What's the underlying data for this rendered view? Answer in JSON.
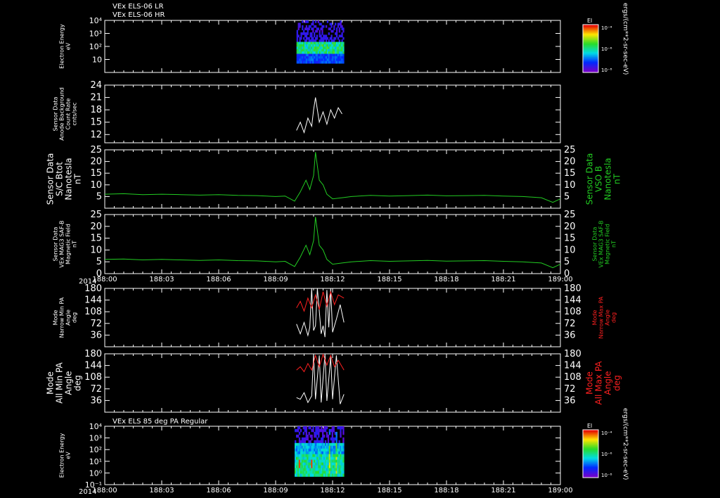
{
  "header": {
    "line1": "VEx ELS-06 LR",
    "line2": "VEx ELS-06 HR",
    "bottom_title": "VEx ELS 85 deg PA Regular"
  },
  "time_axis": {
    "year": "2014",
    "ticks": [
      "188:00",
      "188:03",
      "188:06",
      "188:09",
      "188:12",
      "188:15",
      "188:18",
      "188:21",
      "189:00"
    ]
  },
  "colors": {
    "white": "#ffffff",
    "green": "#22cc22",
    "red": "#ff2020"
  },
  "colorbar": {
    "label": "El",
    "unit": "ergs/(cm**2-sr-sec-eV)",
    "top_ticks": [
      "10⁻⁴",
      "10⁻⁶",
      "10⁻⁸"
    ],
    "bottom_ticks": [
      "10⁻⁴",
      "10⁻⁶",
      "10⁻⁸"
    ]
  },
  "chart_data": [
    {
      "type": "heatmap",
      "panel": "electron-energy-lr-hr",
      "ylabel": [
        "Electron Energy",
        "eV"
      ],
      "yscale": "log",
      "ylim": [
        1,
        10000
      ],
      "yticks": [
        "10",
        "10²",
        "10³",
        "10⁴"
      ],
      "ytick_values": [
        10,
        100,
        1000,
        10000
      ],
      "xrange": [
        0,
        24
      ],
      "data_x_range": [
        10.1,
        12.6
      ],
      "data_y_range": [
        5,
        10000
      ],
      "note": ""
    },
    {
      "type": "line",
      "panel": "anode-background",
      "ylabel": [
        "Sensor Data",
        "Anode Background",
        "Count Rate",
        "cnts/sec"
      ],
      "ylim": [
        10,
        24
      ],
      "yticks": [
        12,
        15,
        18,
        21,
        24
      ],
      "series": [
        {
          "color": "white",
          "x": [
            10.1,
            10.3,
            10.5,
            10.7,
            10.9,
            11.0,
            11.1,
            11.3,
            11.5,
            11.7,
            11.9,
            12.1,
            12.3,
            12.5
          ],
          "y": [
            13,
            15,
            12.5,
            16,
            14,
            18,
            21,
            15,
            17.5,
            14.5,
            18,
            16,
            18.5,
            17
          ]
        }
      ]
    },
    {
      "type": "line",
      "panel": "sc-btot",
      "ylabel": [
        "Sensor Data",
        "S/C Btot",
        "Nanotesla",
        "nT"
      ],
      "ylabel_right": [
        "Sensor Data",
        "VSO B",
        "Nanotesla",
        "nT"
      ],
      "ylim": [
        0,
        25
      ],
      "yticks": [
        5,
        10,
        15,
        20,
        25
      ],
      "series": [
        {
          "color": "green",
          "x": [
            0,
            1,
            2,
            3,
            4,
            5,
            6,
            7,
            8,
            9,
            9.5,
            10,
            10.3,
            10.6,
            10.8,
            11.0,
            11.1,
            11.3,
            11.5,
            11.7,
            12,
            12.5,
            13,
            14,
            15,
            16,
            17,
            18,
            19,
            20,
            21,
            22,
            23,
            23.6,
            24
          ],
          "y": [
            6,
            6.2,
            5.8,
            6,
            5.8,
            5.6,
            5.8,
            5.5,
            5.4,
            5,
            5.2,
            3,
            7,
            12,
            8,
            14,
            24,
            12,
            10,
            6,
            4,
            4.5,
            5,
            5.5,
            5.2,
            5.4,
            5.6,
            5.3,
            5.4,
            5.5,
            5.2,
            5,
            4.5,
            2.5,
            4
          ]
        }
      ]
    },
    {
      "type": "line",
      "panel": "mag-saf-b",
      "ylabel": [
        "Sensor Data",
        "VEx MAG3 SAF-B",
        "Magnetic Field",
        "nT"
      ],
      "ylabel_right": [
        "Sensor Data",
        "VEx MAG3 SAF-B",
        "Magnetic Field",
        "nT"
      ],
      "ylim": [
        0,
        25
      ],
      "yticks": [
        0,
        5,
        10,
        15,
        20,
        25
      ],
      "series": [
        {
          "color": "green",
          "x": [
            0,
            1,
            2,
            3,
            4,
            5,
            6,
            7,
            8,
            9,
            9.5,
            10,
            10.3,
            10.6,
            10.8,
            11.0,
            11.1,
            11.3,
            11.5,
            11.7,
            12,
            12.5,
            13,
            14,
            15,
            16,
            17,
            18,
            19,
            20,
            21,
            22,
            23,
            23.6,
            24
          ],
          "y": [
            6,
            6.2,
            5.8,
            6,
            5.8,
            5.6,
            5.8,
            5.5,
            5.4,
            5,
            5.2,
            3,
            7,
            12,
            8,
            14,
            24,
            12,
            10,
            6,
            4,
            4.5,
            5,
            5.5,
            5.2,
            5.4,
            5.6,
            5.3,
            5.4,
            5.5,
            5.2,
            5,
            4.5,
            2.5,
            4
          ]
        }
      ]
    },
    {
      "type": "line",
      "panel": "narrow-pa",
      "ylabel": [
        "Mode",
        "Narrow Min PA",
        "Angle",
        "deg"
      ],
      "ylabel_right": [
        "Mode",
        "Narrow Max PA",
        "Angle",
        "deg"
      ],
      "ylim": [
        0,
        180
      ],
      "yticks": [
        36,
        72,
        108,
        144,
        180
      ],
      "series": [
        {
          "name": "Narrow Min PA",
          "color": "white",
          "x": [
            10.1,
            10.3,
            10.5,
            10.7,
            10.8,
            10.9,
            11.0,
            11.1,
            11.2,
            11.4,
            11.5,
            11.6,
            11.7,
            11.8,
            11.9,
            12.0,
            12.2,
            12.4,
            12.6
          ],
          "y": [
            70,
            40,
            75,
            35,
            60,
            180,
            50,
            65,
            180,
            40,
            65,
            30,
            175,
            60,
            180,
            45,
            85,
            130,
            75
          ]
        },
        {
          "name": "Narrow Max PA",
          "color": "red",
          "x": [
            10.1,
            10.3,
            10.5,
            10.7,
            10.9,
            11.1,
            11.3,
            11.5,
            11.7,
            11.9,
            12.1,
            12.3,
            12.6
          ],
          "y": [
            120,
            140,
            110,
            150,
            120,
            160,
            115,
            170,
            125,
            170,
            130,
            160,
            150
          ]
        }
      ]
    },
    {
      "type": "line",
      "panel": "all-pa",
      "ylabel": [
        "Mode",
        "All Min PA",
        "Angle",
        "deg"
      ],
      "ylabel_right": [
        "Mode",
        "All Max PA",
        "Angle",
        "deg"
      ],
      "ylim": [
        0,
        180
      ],
      "yticks": [
        36,
        72,
        108,
        144,
        180
      ],
      "series": [
        {
          "name": "All Min PA",
          "color": "white",
          "x": [
            10.1,
            10.3,
            10.5,
            10.7,
            10.9,
            11.0,
            11.1,
            11.3,
            11.4,
            11.6,
            11.7,
            11.9,
            12.0,
            12.2,
            12.4,
            12.6
          ],
          "y": [
            45,
            40,
            60,
            30,
            50,
            180,
            40,
            175,
            30,
            180,
            35,
            170,
            40,
            175,
            25,
            55
          ]
        },
        {
          "name": "All Max PA",
          "color": "red",
          "x": [
            10.1,
            10.3,
            10.5,
            10.7,
            10.9,
            11.1,
            11.3,
            11.5,
            11.7,
            11.9,
            12.1,
            12.3,
            12.6
          ],
          "y": [
            130,
            140,
            125,
            150,
            130,
            175,
            140,
            178,
            145,
            175,
            140,
            160,
            130
          ]
        }
      ]
    },
    {
      "type": "heatmap",
      "panel": "electron-energy-85deg",
      "ylabel": [
        "Electron Energy",
        "eV"
      ],
      "yscale": "log",
      "ylim": [
        0.1,
        10000
      ],
      "yticks": [
        "10⁻¹",
        "10⁰",
        "10¹",
        "10²",
        "10³",
        "10⁴"
      ],
      "ytick_values": [
        0.1,
        1,
        10,
        100,
        1000,
        10000
      ],
      "xrange": [
        0,
        24
      ],
      "data_x_range": [
        10.0,
        12.6
      ],
      "data_y_range": [
        0.5,
        10000
      ]
    }
  ]
}
